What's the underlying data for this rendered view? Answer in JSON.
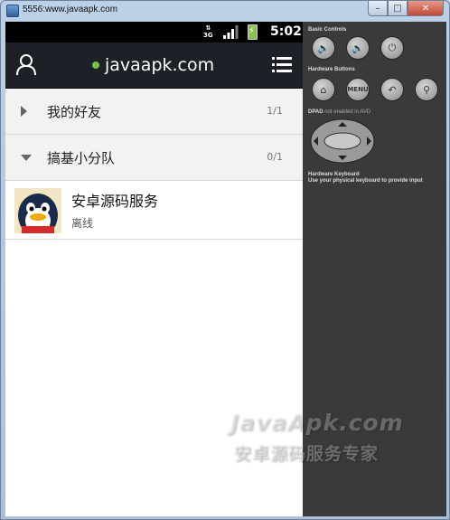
{
  "window": {
    "title": "5556:www.javaapk.com",
    "buttons": [
      "–",
      "□",
      "✕"
    ]
  },
  "statusbar": {
    "network": "3G",
    "time": "5:02"
  },
  "actionbar": {
    "title": "javaapk.com"
  },
  "groups": [
    {
      "name": "我的好友",
      "count": "1/1",
      "expanded": false
    },
    {
      "name": "搞基小分队",
      "count": "0/1",
      "expanded": true
    }
  ],
  "friends": [
    {
      "name": "安卓源码服务",
      "status": "离线"
    }
  ],
  "controls": {
    "basic_controls": "Basic Controls",
    "hardware_buttons": "Hardware Buttons",
    "menu_label": "MENU",
    "dpad_label": "DPAD",
    "dpad_note": "not enabled in AVD",
    "keyboard_label": "Hardware Keyboard",
    "keyboard_note": "Use your physical keyboard to provide input"
  },
  "watermark": {
    "line1": "JavaApk.com",
    "line2": "安卓源码服务专家"
  },
  "colors": {
    "online": "#7ac142",
    "actionbar": "#1d2127",
    "panel": "#3a3a3a"
  }
}
